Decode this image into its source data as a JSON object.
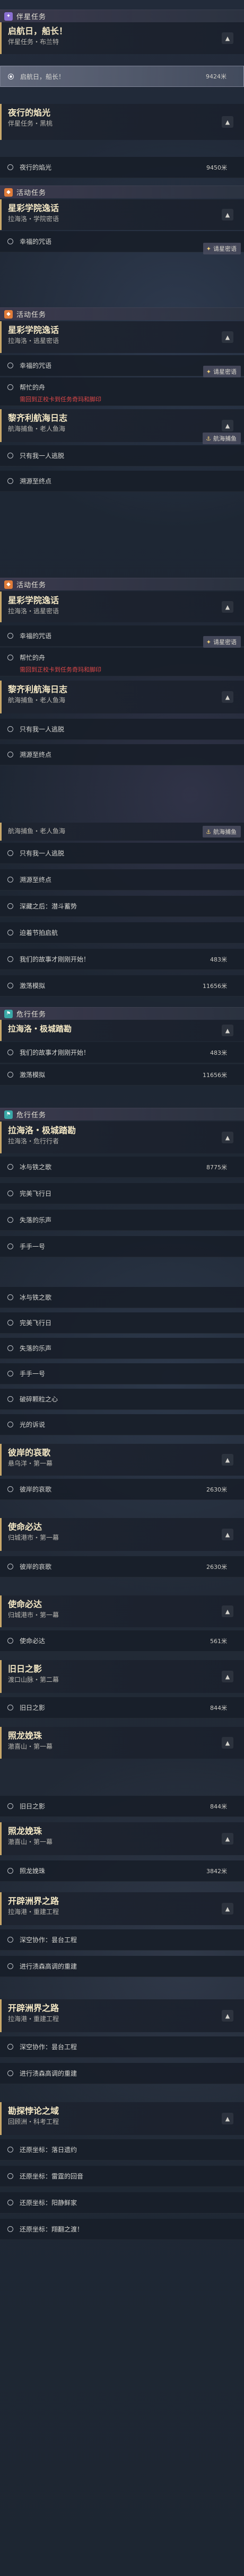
{
  "categories": {
    "companion": "伴星任务",
    "event": "活动任务",
    "danger": "危行任务"
  },
  "groups": {
    "g1": {
      "title": "启航日，船长！",
      "sub": "伴星任务・布兰特"
    },
    "g2": {
      "title": "夜行的焰光",
      "sub": "伴星任务・黑桃"
    },
    "g3": {
      "title": "星彩学院逸话",
      "sub": "拉海洛・学院密语"
    },
    "g4": {
      "title": "星彩学院逸话",
      "sub": "拉海洛・逃星密语"
    },
    "g5": {
      "title": "黎齐利航海日志",
      "sub": "航海捕鱼・老人鱼海"
    },
    "g6": {
      "title": "星彩学院逸话",
      "sub": "拉海洛・逃星密语"
    },
    "g7": {
      "title": "黎齐利航海日志",
      "sub": "航海捕鱼・老人鱼海"
    },
    "g8": {
      "title": "航海捕鱼・老人鱼海",
      "sub": ""
    },
    "g9": {
      "title": "拉海洛・极城踏勘",
      "sub": ""
    },
    "g10": {
      "title": "拉海洛・极城踏勘",
      "sub": "拉海洛・危行行者"
    },
    "g11": {
      "title": "彼岸的哀歌",
      "sub": "悬乌洋・第一幕"
    },
    "g12": {
      "title": "使命必达",
      "sub": "归城港市・第一幕"
    },
    "g13": {
      "title": "使命必达",
      "sub": "归城港市・第一幕"
    },
    "g14": {
      "title": "旧日之影",
      "sub": "渡口山脉・第二幕"
    },
    "g15": {
      "title": "照龙娩珠",
      "sub": "澈喜山・第一幕"
    },
    "g16": {
      "title": "照龙娩珠",
      "sub": "澈喜山・第一幕"
    },
    "g17": {
      "title": "开辟洲界之路",
      "sub": "拉海港・重建工程"
    },
    "g18": {
      "title": "开辟洲界之路",
      "sub": "拉海港・重建工程"
    },
    "g19": {
      "title": "勘探悖论之域",
      "sub": "回顾洲・科考工程"
    }
  },
  "rows": {
    "r1": {
      "label": "启航日，船长！",
      "num": "9424米"
    },
    "r2": {
      "label": "夜行的焰光",
      "num": "9450米"
    },
    "r3": {
      "label": "幸福的咒语"
    },
    "r4": {
      "label": "幸福的咒语"
    },
    "r5": {
      "label": "帮忙的舟",
      "warn": "需回到正校卡到任务奇玛和脚印"
    },
    "r6": {
      "label": "只有我一人逃脱"
    },
    "r7": {
      "label": "溯源至终点"
    },
    "r8": {
      "label": "幸福的咒语"
    },
    "r9": {
      "label": "帮忙的舟",
      "warn": "需回到正校卡到任务奇玛和脚印"
    },
    "r10": {
      "label": "只有我一人逃脱"
    },
    "r11": {
      "label": "溯源至终点"
    },
    "r12": {
      "label": "只有我一人逃脱"
    },
    "r13": {
      "label": "溯源至终点"
    },
    "r14": {
      "label": "深藏之后：潜斗蓄势"
    },
    "r15": {
      "label": "迫着节拍启航"
    },
    "r16": {
      "label": "我们的故事才刚刚开始！",
      "num": "483米"
    },
    "r17": {
      "label": "激荡模拟",
      "num": "11656米"
    },
    "r18": {
      "label": "我们的故事才刚刚开始！",
      "num": "483米"
    },
    "r19": {
      "label": "激荡模拟",
      "num": "11656米"
    },
    "r20": {
      "label": "冰与铁之歌",
      "num": "8775米"
    },
    "r21": {
      "label": "完美飞行日"
    },
    "r22": {
      "label": "失落的乐声"
    },
    "r23": {
      "label": "手手一号"
    },
    "r24": {
      "label": "冰与铁之歌"
    },
    "r25": {
      "label": "完美飞行日"
    },
    "r26": {
      "label": "失落的乐声"
    },
    "r27": {
      "label": "手手一号"
    },
    "r28": {
      "label": "破碎颗粒之心"
    },
    "r29": {
      "label": "光的诉说"
    },
    "r30": {
      "label": "彼岸的哀歌",
      "num": "2630米"
    },
    "r31": {
      "label": "彼岸的哀歌",
      "num": "2630米"
    },
    "r32": {
      "label": "使命必达",
      "num": "561米"
    },
    "r33": {
      "label": "旧日之影",
      "num": "844米"
    },
    "r34": {
      "label": "旧日之影",
      "num": "844米"
    },
    "r35": {
      "label": "照龙娩珠",
      "num": "3842米"
    },
    "r36": {
      "label": "深空协作：昙台工程"
    },
    "r37": {
      "label": "进行渍森高调的重建"
    },
    "r38": {
      "label": "深空协作：昙台工程"
    },
    "r39": {
      "label": "进行渍森高调的重建"
    },
    "r40": {
      "label": "还原坐标：落日遗约"
    },
    "r41": {
      "label": "还原坐标：雷霆的回音"
    },
    "r42": {
      "label": "还原坐标：阳静鲜家"
    },
    "r43": {
      "label": "还原坐标：翔翻之渡！"
    }
  },
  "tags": {
    "xingzhe": "请星密语",
    "hanghai": "航海捕鱼"
  },
  "colors": {
    "companion_icon": "#8a6fd1",
    "event_icon": "#e07c3a",
    "danger_icon": "#3aa8a8",
    "accent_gold": "#c9a86a",
    "warning_red": "#e04848"
  }
}
